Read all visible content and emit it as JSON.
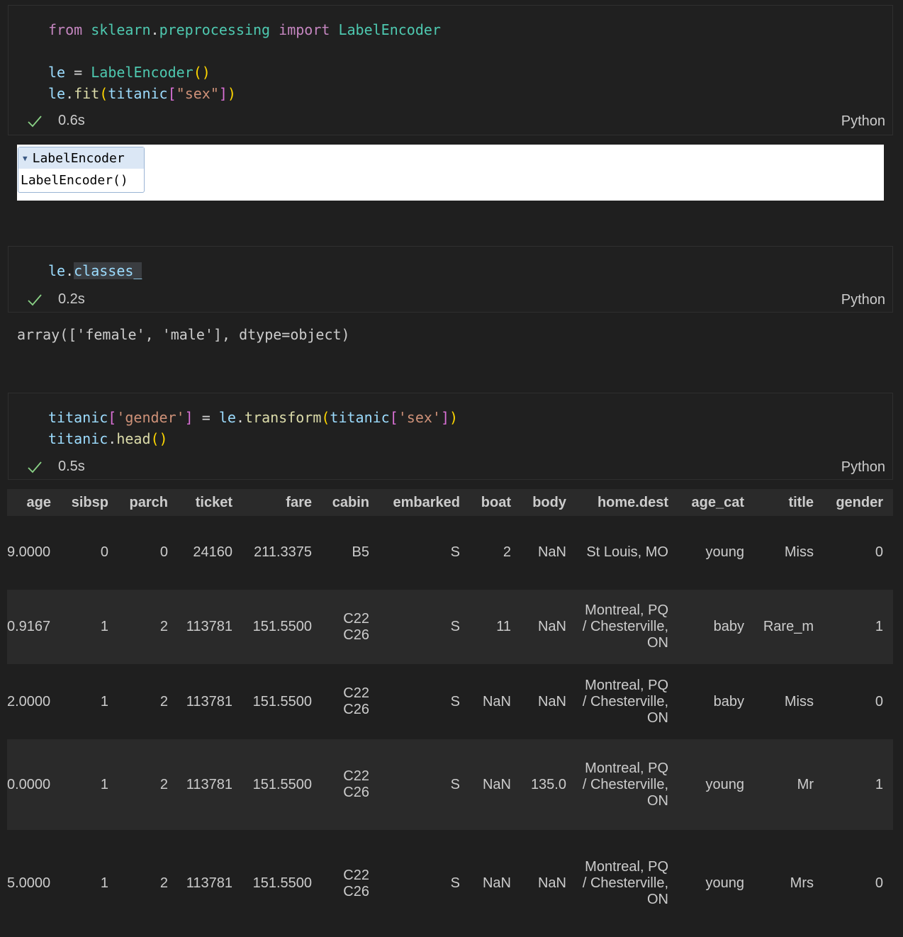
{
  "cells": [
    {
      "status_time": "0.6s",
      "language": "Python"
    },
    {
      "status_time": "0.2s",
      "language": "Python"
    },
    {
      "status_time": "0.5s",
      "language": "Python"
    }
  ],
  "code1": {
    "l1_from": "from",
    "l1_mod": "sklearn",
    "l1_dot": ".",
    "l1_sub": "preprocessing",
    "l1_import": "import",
    "l1_cls": "LabelEncoder",
    "l3_var": "le",
    "l3_eq": "=",
    "l3_cls": "LabelEncoder",
    "l3_parens": "()",
    "l4_var": "le",
    "l4_dot": ".",
    "l4_fn": "fit",
    "l4_open": "(",
    "l4_arg": "titanic",
    "l4_lb": "[",
    "l4_str": "\"sex\"",
    "l4_rb": "]",
    "l4_close": ")"
  },
  "output1": {
    "widget_title": "LabelEncoder",
    "widget_body": "LabelEncoder()"
  },
  "code2": {
    "var": "le",
    "dot": ".",
    "attr": "classes_"
  },
  "output2": {
    "text": "array(['female', 'male'], dtype=object)"
  },
  "code3": {
    "l1_var": "titanic",
    "l1_lb": "[",
    "l1_str": "'gender'",
    "l1_rb": "]",
    "l1_eq": "=",
    "l1_le": "le",
    "l1_dot": ".",
    "l1_fn": "transform",
    "l1_open": "(",
    "l1_arg": "titanic",
    "l1_lb2": "[",
    "l1_str2": "'sex'",
    "l1_rb2": "]",
    "l1_close": ")",
    "l2_var": "titanic",
    "l2_dot": ".",
    "l2_fn": "head",
    "l2_parens": "()"
  },
  "table": {
    "headers": [
      "age",
      "sibsp",
      "parch",
      "ticket",
      "fare",
      "cabin",
      "embarked",
      "boat",
      "body",
      "home.dest",
      "age_cat",
      "title",
      "gender"
    ],
    "rows": [
      [
        "9.0000",
        "0",
        "0",
        "24160",
        "211.3375",
        "B5",
        "S",
        "2",
        "NaN",
        "St Louis, MO",
        "young",
        "Miss",
        "0"
      ],
      [
        "0.9167",
        "1",
        "2",
        "113781",
        "151.5500",
        "C22 C26",
        "S",
        "11",
        "NaN",
        "Montreal, PQ / Chesterville, ON",
        "baby",
        "Rare_m",
        "1"
      ],
      [
        "2.0000",
        "1",
        "2",
        "113781",
        "151.5500",
        "C22 C26",
        "S",
        "NaN",
        "NaN",
        "Montreal, PQ / Chesterville, ON",
        "baby",
        "Miss",
        "0"
      ],
      [
        "0.0000",
        "1",
        "2",
        "113781",
        "151.5500",
        "C22 C26",
        "S",
        "NaN",
        "135.0",
        "Montreal, PQ / Chesterville, ON",
        "young",
        "Mr",
        "1"
      ],
      [
        "5.0000",
        "1",
        "2",
        "113781",
        "151.5500",
        "C22 C26",
        "S",
        "NaN",
        "NaN",
        "Montreal, PQ / Chesterville, ON",
        "young",
        "Mrs",
        "0"
      ]
    ]
  },
  "colors": {
    "background": "#1f1f1f",
    "check": "#89d185",
    "keyword": "#c586c0",
    "module": "#4ec9b0",
    "function": "#dcdcaa",
    "variable": "#9cdcfe",
    "string": "#ce9178"
  },
  "icons": {
    "check": "check-icon",
    "collapse": "triangle-down-icon"
  }
}
